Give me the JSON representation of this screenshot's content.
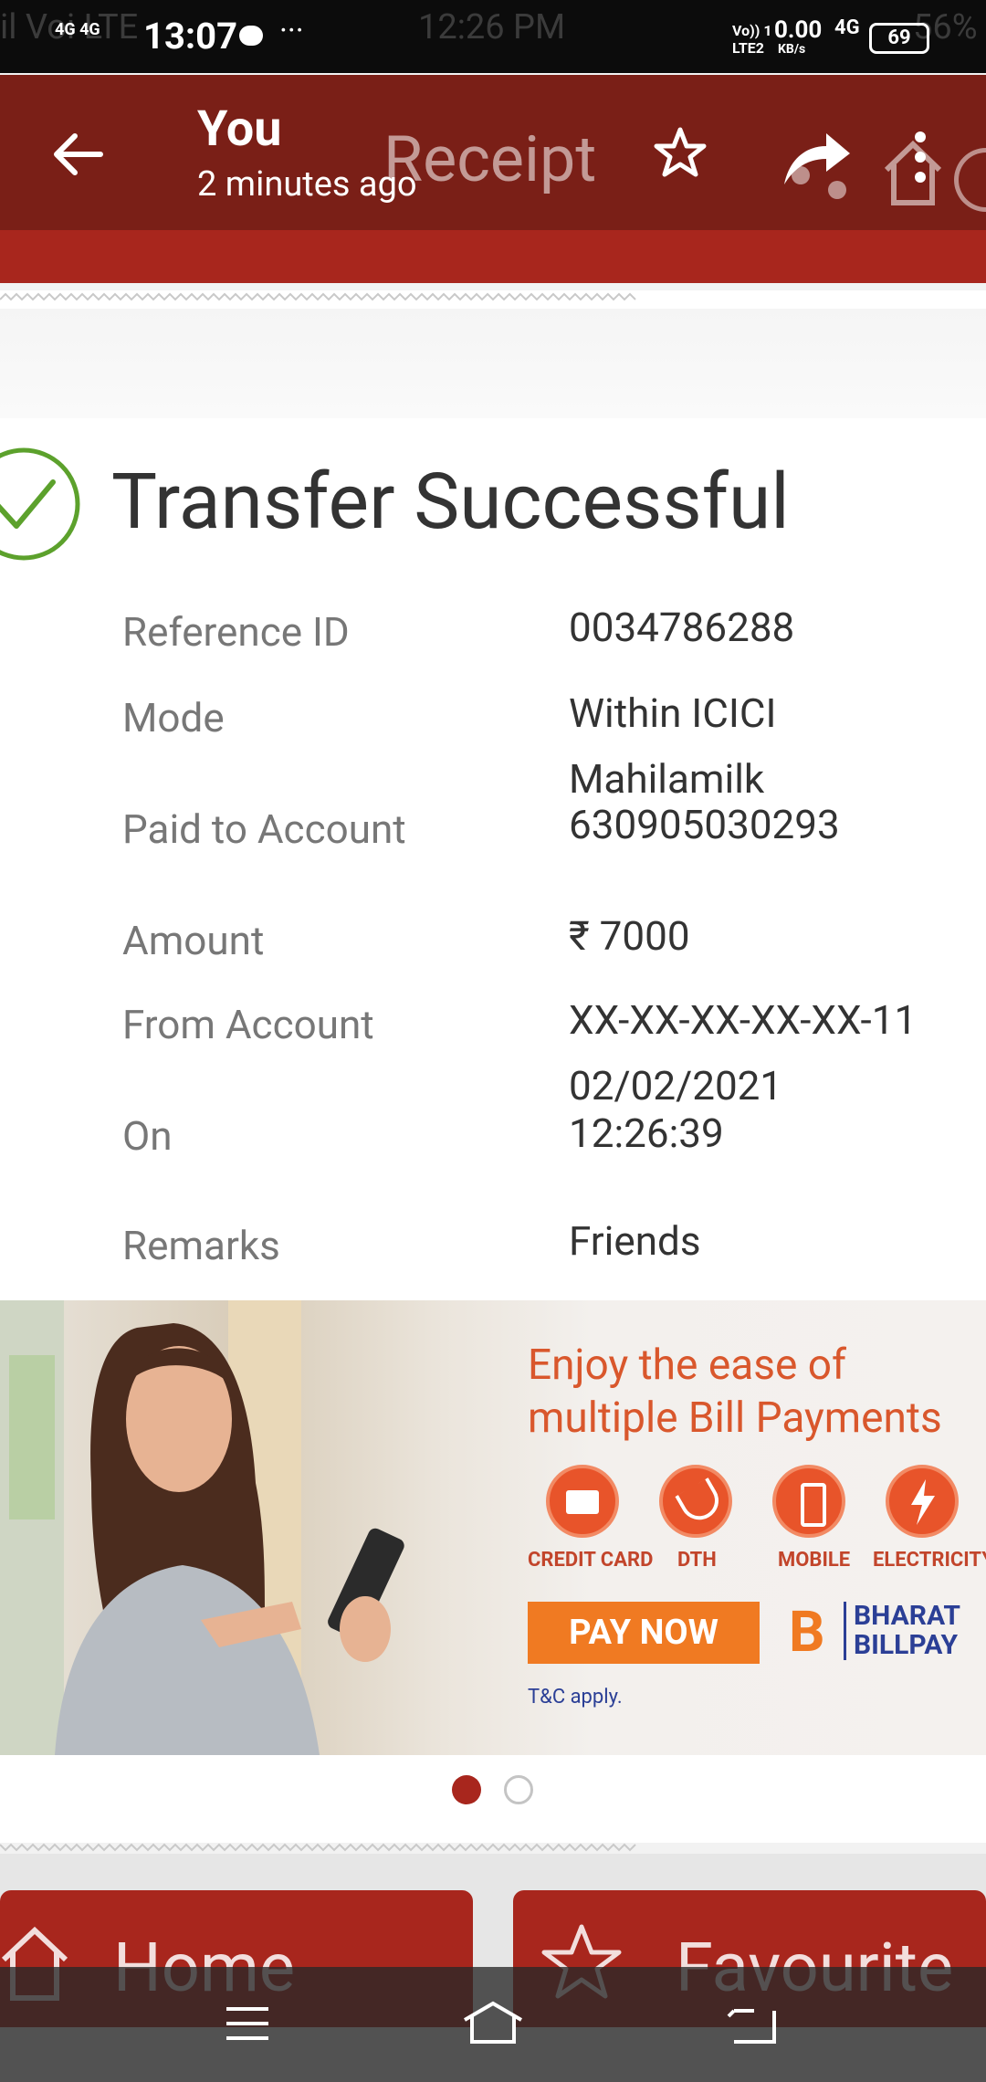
{
  "status": {
    "time": "13:07",
    "net_left": "4G 4G",
    "ghost_left": "il Voi LTE",
    "ghost_time": "12:26 PM",
    "speed": "0.00",
    "speed_unit": "KB/s",
    "net_right": "4G",
    "battery": "69",
    "ghost_battery": "56%"
  },
  "appbar": {
    "title": "You",
    "subtitle": "2 minutes ago",
    "ghost_title": "Receipt"
  },
  "receipt": {
    "headline": "Transfer Successful",
    "rows": [
      {
        "label": "Reference ID",
        "value": "0034786288"
      },
      {
        "label": "Mode",
        "value": "Within ICICI"
      },
      {
        "label": "Paid to Account",
        "value": "Mahilamilk",
        "value2": "630905030293"
      },
      {
        "label": "Amount",
        "value": "₹ 7000"
      },
      {
        "label": "From Account",
        "value": "XX-XX-XX-XX-XX-11"
      },
      {
        "label": "On",
        "value": "02/02/2021",
        "value2": "12:26:39"
      },
      {
        "label": "Remarks",
        "value": "Friends"
      }
    ]
  },
  "banner": {
    "line1": "Enjoy the ease of",
    "line2": "multiple Bill Payments",
    "icons": [
      "CREDIT CARD",
      "DTH",
      "MOBILE",
      "ELECTRICITY"
    ],
    "pay_now": "PAY NOW",
    "brand_b": "B",
    "brand_line1": "BHARAT",
    "brand_line2": "BILLPAY",
    "tc": "T&C apply."
  },
  "carousel": {
    "active_index": 0,
    "count": 2
  },
  "bottom_buttons": {
    "home": "Home",
    "favourite": "Favourite"
  },
  "colors": {
    "appbar": "#7a1f17",
    "accent": "#a8261d",
    "success": "#5ca12c",
    "banner_orange": "#f07a22",
    "banner_blue": "#2b3f96"
  }
}
